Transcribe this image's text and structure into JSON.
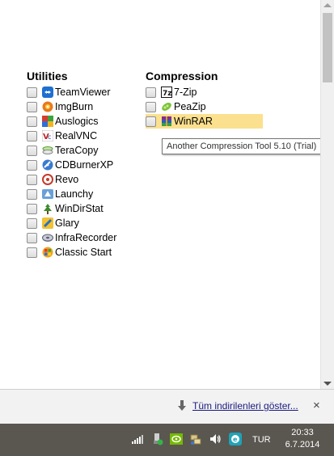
{
  "utilities": {
    "heading": "Utilities",
    "items": [
      {
        "label": "TeamViewer"
      },
      {
        "label": "ImgBurn"
      },
      {
        "label": "Auslogics"
      },
      {
        "label": "RealVNC"
      },
      {
        "label": "TeraCopy"
      },
      {
        "label": "CDBurnerXP"
      },
      {
        "label": "Revo"
      },
      {
        "label": "Launchy"
      },
      {
        "label": "WinDirStat"
      },
      {
        "label": "Glary"
      },
      {
        "label": "InfraRecorder"
      },
      {
        "label": "Classic Start"
      }
    ]
  },
  "compression": {
    "heading": "Compression",
    "items": [
      {
        "label": "7-Zip"
      },
      {
        "label": "PeaZip"
      },
      {
        "label": "WinRAR"
      }
    ]
  },
  "tooltip": "Another Compression Tool 5.10 (Trial)",
  "downloads_bar": {
    "show_all": "Tüm indirilenleri göster...",
    "close": "×"
  },
  "taskbar": {
    "language": "TUR",
    "time": "20:33",
    "date": "6.7.2014"
  },
  "icons": [
    "teamviewer-icon",
    "imgburn-icon",
    "auslogics-icon",
    "realvnc-icon",
    "teracopy-icon",
    "cdburnerxp-icon",
    "revo-icon",
    "launchy-icon",
    "windirstat-icon",
    "glary-icon",
    "infrarecorder-icon",
    "classic-start-icon",
    "7zip-icon",
    "peazip-icon",
    "winrar-icon"
  ]
}
